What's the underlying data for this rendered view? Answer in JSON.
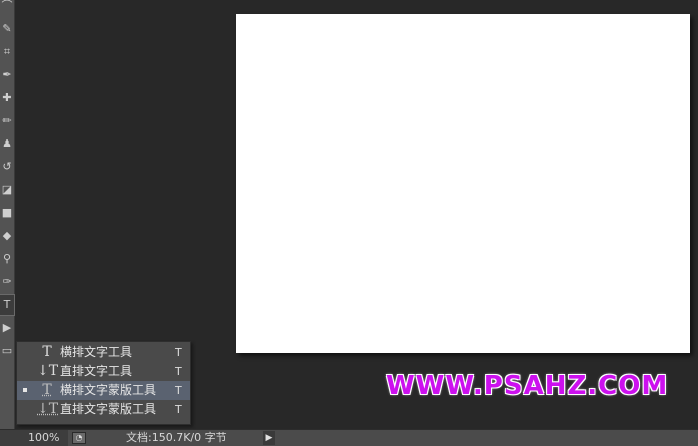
{
  "toolbar": {
    "tools": [
      {
        "name": "lasso-tool",
        "glyph": "⌒"
      },
      {
        "name": "quick-select-tool",
        "glyph": "✎"
      },
      {
        "name": "crop-tool",
        "glyph": "⌗"
      },
      {
        "name": "eyedropper-tool",
        "glyph": "✒"
      },
      {
        "name": "healing-brush-tool",
        "glyph": "✚"
      },
      {
        "name": "brush-tool",
        "glyph": "✏"
      },
      {
        "name": "clone-stamp-tool",
        "glyph": "♟"
      },
      {
        "name": "history-brush-tool",
        "glyph": "↺"
      },
      {
        "name": "eraser-tool",
        "glyph": "◪"
      },
      {
        "name": "gradient-tool",
        "glyph": "■"
      },
      {
        "name": "blur-tool",
        "glyph": "◆"
      },
      {
        "name": "dodge-tool",
        "glyph": "⚲"
      },
      {
        "name": "pen-tool",
        "glyph": "✑"
      },
      {
        "name": "type-tool",
        "glyph": "T"
      },
      {
        "name": "path-select-tool",
        "glyph": "▶"
      },
      {
        "name": "shape-tool",
        "glyph": "▭"
      }
    ]
  },
  "flyout": {
    "items": [
      {
        "icon": "T",
        "label": "横排文字工具",
        "key": "T",
        "selected": false
      },
      {
        "icon": "↓T",
        "label": "直排文字工具",
        "key": "T",
        "selected": false
      },
      {
        "icon": "T",
        "label": "横排文字蒙版工具",
        "key": "T",
        "selected": true
      },
      {
        "icon": "↓T",
        "label": "直排文字蒙版工具",
        "key": "T",
        "selected": false
      }
    ]
  },
  "watermark": "WWW.PSAHZ.COM",
  "status": {
    "zoom": "100%",
    "doc_info": "文档:150.7K/0 字节",
    "arrow": "▶"
  }
}
